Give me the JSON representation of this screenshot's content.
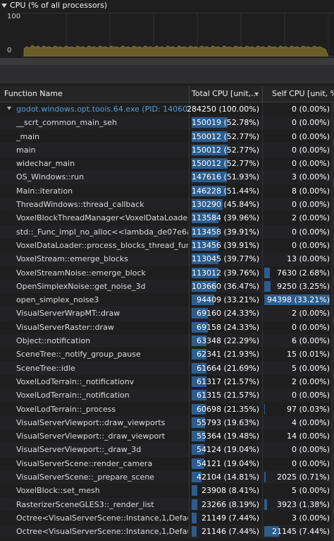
{
  "cpu_chart": {
    "title": "CPU (% of all processors)",
    "y_max_label": "100",
    "y_min_label": "0"
  },
  "table": {
    "columns": [
      {
        "label": "Function Name"
      },
      {
        "label": "Total CPU [unit,..."
      },
      {
        "label": "Self CPU [unit, %]"
      }
    ],
    "rows": [
      {
        "name": "godot.windows.opt.tools.64.exe (PID: 14060)",
        "total": "284250 (100.00%)",
        "total_pct": 100.0,
        "self": "0 (0.00%)",
        "self_pct": 0.0,
        "root": true
      },
      {
        "name": "__scrt_common_main_seh",
        "total": "150019 (52.78%)",
        "total_pct": 52.78,
        "self": "0 (0.00%)",
        "self_pct": 0.0
      },
      {
        "name": "_main",
        "total": "150012 (52.77%)",
        "total_pct": 52.77,
        "self": "0 (0.00%)",
        "self_pct": 0.0
      },
      {
        "name": "main",
        "total": "150012 (52.77%)",
        "total_pct": 52.77,
        "self": "0 (0.00%)",
        "self_pct": 0.0
      },
      {
        "name": "widechar_main",
        "total": "150012 (52.77%)",
        "total_pct": 52.77,
        "self": "0 (0.00%)",
        "self_pct": 0.0
      },
      {
        "name": "OS_Windows::run",
        "total": "147616 (51.93%)",
        "total_pct": 51.93,
        "self": "3 (0.00%)",
        "self_pct": 0.0
      },
      {
        "name": "Main::iteration",
        "total": "146228 (51.44%)",
        "total_pct": 51.44,
        "self": "8 (0.00%)",
        "self_pct": 0.0
      },
      {
        "name": "ThreadWindows::thread_callback",
        "total": "130290 (45.84%)",
        "total_pct": 45.84,
        "self": "0 (0.00%)",
        "self_pct": 0.0
      },
      {
        "name": "VoxelBlockThreadManager<VoxelDataLoader::In...",
        "total": "113584 (39.96%)",
        "total_pct": 39.96,
        "self": "2 (0.00%)",
        "self_pct": 0.0
      },
      {
        "name": "std::_Func_impl_no_alloc<<lambda_de07e6a3964...",
        "total": "113458 (39.91%)",
        "total_pct": 39.91,
        "self": "0 (0.00%)",
        "self_pct": 0.0
      },
      {
        "name": "VoxelDataLoader::process_blocks_thread_func",
        "total": "113456 (39.91%)",
        "total_pct": 39.91,
        "self": "0 (0.00%)",
        "self_pct": 0.0
      },
      {
        "name": "VoxelStream::emerge_blocks",
        "total": "113045 (39.77%)",
        "total_pct": 39.77,
        "self": "13 (0.00%)",
        "self_pct": 0.0
      },
      {
        "name": "VoxelStreamNoise::emerge_block",
        "total": "113012 (39.76%)",
        "total_pct": 39.76,
        "self": "7630 (2.68%)",
        "self_pct": 2.68
      },
      {
        "name": "OpenSimplexNoise::get_noise_3d",
        "total": "103660 (36.47%)",
        "total_pct": 36.47,
        "self": "9250 (3.25%)",
        "self_pct": 3.25
      },
      {
        "name": "open_simplex_noise3",
        "total": "94409 (33.21%)",
        "total_pct": 33.21,
        "self": "94398 (33.21%)",
        "self_pct": 33.21
      },
      {
        "name": "VisualServerWrapMT::draw",
        "total": "69160 (24.33%)",
        "total_pct": 24.33,
        "self": "2 (0.00%)",
        "self_pct": 0.0
      },
      {
        "name": "VisualServerRaster::draw",
        "total": "69158 (24.33%)",
        "total_pct": 24.33,
        "self": "0 (0.00%)",
        "self_pct": 0.0
      },
      {
        "name": "Object::notification",
        "total": "63348 (22.29%)",
        "total_pct": 22.29,
        "self": "6 (0.00%)",
        "self_pct": 0.0
      },
      {
        "name": "SceneTree::_notify_group_pause",
        "total": "62341 (21.93%)",
        "total_pct": 21.93,
        "self": "15 (0.01%)",
        "self_pct": 0.01
      },
      {
        "name": "SceneTree::idle",
        "total": "61664 (21.69%)",
        "total_pct": 21.69,
        "self": "5 (0.00%)",
        "self_pct": 0.0
      },
      {
        "name": "VoxelLodTerrain::_notificationv",
        "total": "61317 (21.57%)",
        "total_pct": 21.57,
        "self": "2 (0.00%)",
        "self_pct": 0.0
      },
      {
        "name": "VoxelLodTerrain::_notification",
        "total": "61315 (21.57%)",
        "total_pct": 21.57,
        "self": "0 (0.00%)",
        "self_pct": 0.0
      },
      {
        "name": "VoxelLodTerrain::_process",
        "total": "60698 (21.35%)",
        "total_pct": 21.35,
        "self": "97 (0.03%)",
        "self_pct": 0.03
      },
      {
        "name": "VisualServerViewport::draw_viewports",
        "total": "55793 (19.63%)",
        "total_pct": 19.63,
        "self": "4 (0.00%)",
        "self_pct": 0.0
      },
      {
        "name": "VisualServerViewport::_draw_viewport",
        "total": "55364 (19.48%)",
        "total_pct": 19.48,
        "self": "14 (0.00%)",
        "self_pct": 0.0
      },
      {
        "name": "VisualServerViewport::_draw_3d",
        "total": "54124 (19.04%)",
        "total_pct": 19.04,
        "self": "0 (0.00%)",
        "self_pct": 0.0
      },
      {
        "name": "VisualServerScene::render_camera",
        "total": "54121 (19.04%)",
        "total_pct": 19.04,
        "self": "0 (0.00%)",
        "self_pct": 0.0
      },
      {
        "name": "VisualServerScene::_prepare_scene",
        "total": "42104 (14.81%)",
        "total_pct": 14.81,
        "self": "2025 (0.71%)",
        "self_pct": 0.71
      },
      {
        "name": "VoxelBlock::set_mesh",
        "total": "23908 (8.41%)",
        "total_pct": 8.41,
        "self": "5 (0.00%)",
        "self_pct": 0.0
      },
      {
        "name": "RasterizerSceneGLES3::_render_list",
        "total": "23266 (8.19%)",
        "total_pct": 8.19,
        "self": "3923 (1.38%)",
        "self_pct": 1.38
      },
      {
        "name": "Octree<VisualServerScene::Instance,1,DefaultAllo...",
        "total": "21149 (7.44%)",
        "total_pct": 7.44,
        "self": "3 (0.00%)",
        "self_pct": 0.0
      },
      {
        "name": "Octree<VisualServerScene::Instance,1,DefaultAllo...",
        "total": "21146 (7.44%)",
        "total_pct": 7.44,
        "self": "21145 (7.44%)",
        "self_pct": 7.44
      }
    ]
  }
}
